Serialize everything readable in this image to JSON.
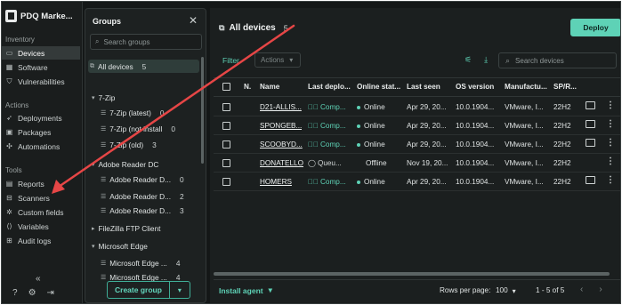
{
  "app": {
    "title": "PDQ Marke..."
  },
  "nav": {
    "sections": [
      {
        "label": "Inventory"
      },
      {
        "label": "Actions"
      },
      {
        "label": "Tools"
      }
    ],
    "items": [
      {
        "label": "Devices",
        "icon": "monitor-icon"
      },
      {
        "label": "Software",
        "icon": "grid-icon"
      },
      {
        "label": "Vulnerabilities",
        "icon": "shield-icon"
      },
      {
        "label": "Deployments",
        "icon": "rocket-icon"
      },
      {
        "label": "Packages",
        "icon": "package-icon"
      },
      {
        "label": "Automations",
        "icon": "automation-icon"
      },
      {
        "label": "Reports",
        "icon": "document-icon"
      },
      {
        "label": "Scanners",
        "icon": "scanner-icon"
      },
      {
        "label": "Custom fields",
        "icon": "custom-fields-icon"
      },
      {
        "label": "Variables",
        "icon": "variables-icon"
      },
      {
        "label": "Audit logs",
        "icon": "audit-icon"
      }
    ],
    "active": "Devices"
  },
  "groups": {
    "title": "Groups",
    "search_placeholder": "Search groups",
    "create_label": "Create group",
    "rows": [
      {
        "label": "All devices",
        "count": "5",
        "type": "all",
        "selected": true
      },
      {
        "label": "7-Zip",
        "count": "",
        "type": "folder"
      },
      {
        "label": "7-Zip (latest)",
        "count": "0",
        "type": "group"
      },
      {
        "label": "7-Zip (not install",
        "count": "0",
        "type": "group"
      },
      {
        "label": "7-Zip (old)",
        "count": "3",
        "type": "group"
      },
      {
        "label": "Adobe Reader DC",
        "count": "",
        "type": "folder"
      },
      {
        "label": "Adobe Reader D...",
        "count": "0",
        "type": "group"
      },
      {
        "label": "Adobe Reader D...",
        "count": "2",
        "type": "group"
      },
      {
        "label": "Adobe Reader D...",
        "count": "3",
        "type": "group"
      },
      {
        "label": "FileZilla FTP Client",
        "count": "",
        "type": "folder-collapsed"
      },
      {
        "label": "Microsoft Edge",
        "count": "",
        "type": "folder"
      },
      {
        "label": "Microsoft Edge ...",
        "count": "4",
        "type": "group"
      },
      {
        "label": "Microsoft Edge ...",
        "count": "4",
        "type": "group"
      }
    ]
  },
  "main": {
    "title": "All devices",
    "count": "5",
    "deploy_label": "Deploy",
    "filter_label": "Filter",
    "actions_label": "Actions",
    "search_placeholder": "Search devices",
    "columns": [
      "N.",
      "Name",
      "Last deplo...",
      "Online stat...",
      "Last seen",
      "OS version",
      "Manufactu...",
      "SP/R..."
    ],
    "rows": [
      {
        "name": "D21-ALLIS...",
        "deploy": "Comp...",
        "deploy_state": "complete",
        "online": "Online",
        "is_online": true,
        "last_seen": "Apr 29, 20...",
        "os": "10.0.1904...",
        "manufacturer": "VMware, I...",
        "sp": "22H2",
        "remote": true
      },
      {
        "name": "SPONGEB...",
        "deploy": "Comp...",
        "deploy_state": "complete",
        "online": "Online",
        "is_online": true,
        "last_seen": "Apr 29, 20...",
        "os": "10.0.1904...",
        "manufacturer": "VMware, I...",
        "sp": "22H2",
        "remote": true
      },
      {
        "name": "SCOOBYD...",
        "deploy": "Comp...",
        "deploy_state": "complete",
        "online": "Online",
        "is_online": true,
        "last_seen": "Apr 29, 20...",
        "os": "10.0.1904...",
        "manufacturer": "VMware, I...",
        "sp": "22H2",
        "remote": true
      },
      {
        "name": "DONATELLO",
        "deploy": "Queu...",
        "deploy_state": "queued",
        "online": "Offline",
        "is_online": false,
        "last_seen": "Nov 19, 20...",
        "os": "10.0.1904...",
        "manufacturer": "VMware, I...",
        "sp": "22H2",
        "remote": false
      },
      {
        "name": "HOMERS",
        "deploy": "Comp...",
        "deploy_state": "complete",
        "online": "Online",
        "is_online": true,
        "last_seen": "Apr 29, 20...",
        "os": "10.0.1904...",
        "manufacturer": "VMware, I...",
        "sp": "22H2",
        "remote": true
      }
    ],
    "install_agent_label": "Install agent",
    "rows_per_page_label": "Rows per page:",
    "rows_per_page": "100",
    "range": "1 - 5 of 5"
  },
  "colors": {
    "accent": "#5ed2b6",
    "arrow": "#e64646",
    "background": "#141717"
  }
}
